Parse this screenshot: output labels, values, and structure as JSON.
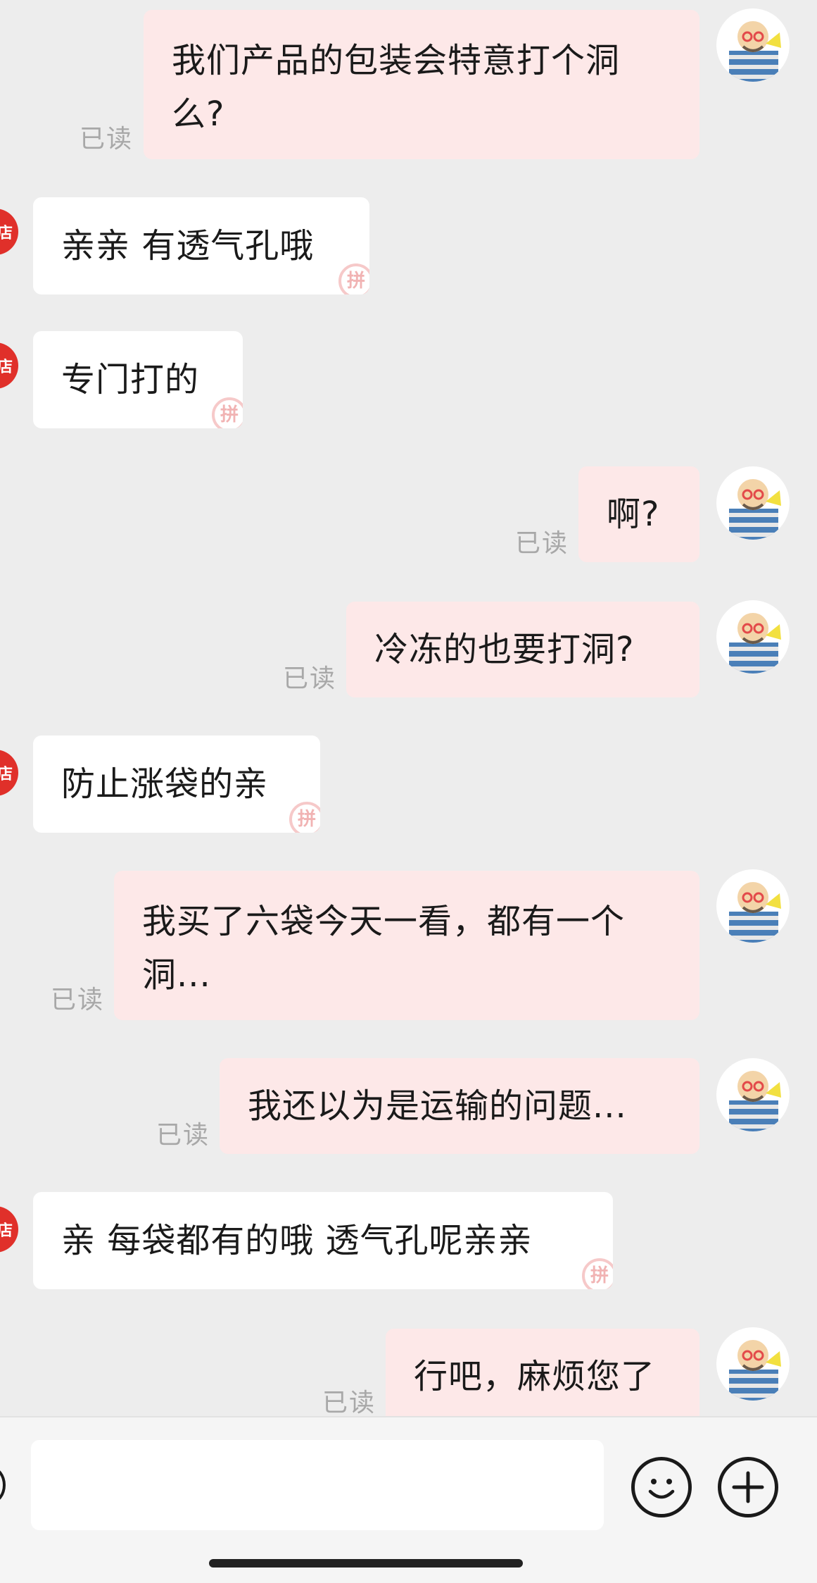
{
  "messages": [
    {
      "from": "me",
      "text": "我们产品的包装会特意打个洞\n么?",
      "read": "已读"
    },
    {
      "from": "shop",
      "text": "亲亲 有透气孔哦"
    },
    {
      "from": "shop",
      "text": "专门打的"
    },
    {
      "from": "me",
      "text": "啊?",
      "read": "已读"
    },
    {
      "from": "me",
      "text": "冷冻的也要打洞?",
      "read": "已读"
    },
    {
      "from": "shop",
      "text": "防止涨袋的亲"
    },
    {
      "from": "me",
      "text": "我买了六袋今天一看，都有一个\n洞...",
      "read": "已读"
    },
    {
      "from": "me",
      "text": "我还以为是运输的问题...",
      "read": "已读"
    },
    {
      "from": "shop",
      "text": "亲 每袋都有的哦 透气孔呢亲亲"
    },
    {
      "from": "me",
      "text": "行吧，麻烦您了",
      "read": "已读"
    }
  ],
  "shop_avatar_glyph": "店",
  "bubble_stamp_glyph": "拼",
  "colors": {
    "background": "#ededed",
    "outgoing_bubble": "#fde8e8",
    "incoming_bubble": "#ffffff",
    "shop_avatar": "#e0302a",
    "read_receipt": "#a8a8a8"
  },
  "icons": {
    "voice": "voice-icon",
    "emoji": "emoji-icon",
    "more": "plus-icon"
  }
}
